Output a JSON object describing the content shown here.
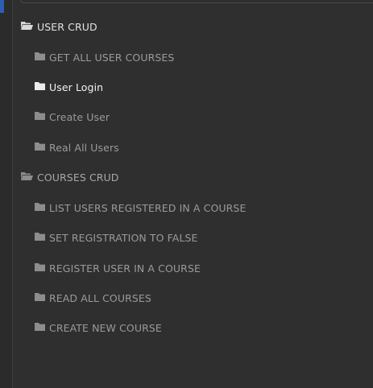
{
  "tree": {
    "groups": [
      {
        "label": "USER CRUD",
        "state": "open",
        "items": [
          {
            "label": "GET ALL USER COURSES",
            "active": false
          },
          {
            "label": "User Login",
            "active": true
          },
          {
            "label": "Create User",
            "active": false
          },
          {
            "label": "Real All Users",
            "active": false
          }
        ]
      },
      {
        "label": "COURSES CRUD",
        "state": "open",
        "items": [
          {
            "label": "LIST USERS REGISTERED IN A COURSE",
            "active": false
          },
          {
            "label": "SET REGISTRATION TO FALSE",
            "active": false
          },
          {
            "label": "REGISTER USER IN A COURSE",
            "active": false
          },
          {
            "label": "READ ALL COURSES",
            "active": false
          },
          {
            "label": "CREATE NEW COURSE",
            "active": false
          }
        ]
      }
    ]
  },
  "colors": {
    "background": "#2f2f2f",
    "text_active": "#f2f2f2",
    "text_muted": "#9a9a9a",
    "rail_accent": "#2c5fb0"
  },
  "icons": {
    "group_icon": "folder-open-icon",
    "item_icon": "folder-icon"
  }
}
